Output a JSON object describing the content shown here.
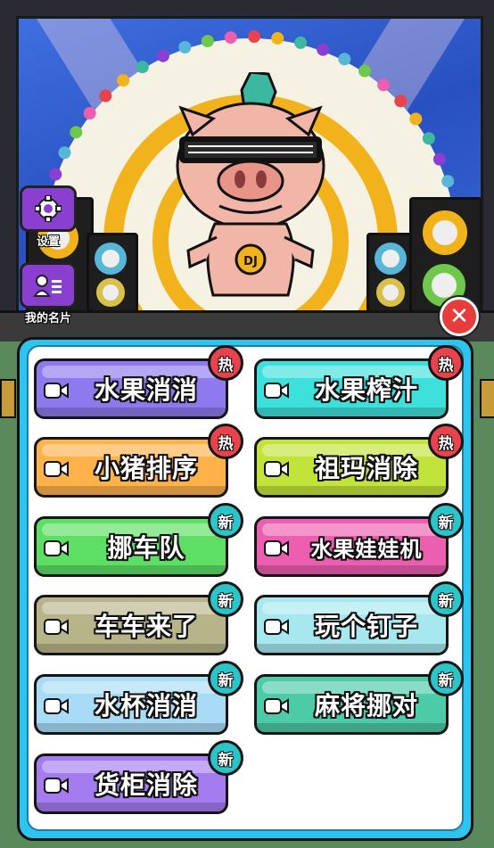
{
  "side_menu": {
    "settings_label": "设置",
    "card_label": "我的名片"
  },
  "pig_medal_text": "DJ",
  "games": [
    {
      "name": "水果消消",
      "badge": "热",
      "badge_type": "hot",
      "color": "#8f79ef"
    },
    {
      "name": "水果榨汁",
      "badge": "热",
      "badge_type": "hot",
      "color": "#3ee0dc"
    },
    {
      "name": "小猪排序",
      "badge": "热",
      "badge_type": "hot",
      "color": "#ffb14a"
    },
    {
      "name": "祖玛消除",
      "badge": "热",
      "badge_type": "hot",
      "color": "#c2e43a"
    },
    {
      "name": "挪车队",
      "badge": "新",
      "badge_type": "new",
      "color": "#5ddf64"
    },
    {
      "name": "水果娃娃机",
      "badge": "新",
      "badge_type": "new",
      "color": "#ec5fb0"
    },
    {
      "name": "车车来了",
      "badge": "新",
      "badge_type": "new",
      "color": "#b8b48a"
    },
    {
      "name": "玩个钉子",
      "badge": "新",
      "badge_type": "new",
      "color": "#a6e8ee"
    },
    {
      "name": "水杯消消",
      "badge": "新",
      "badge_type": "new",
      "color": "#a8dcf6"
    },
    {
      "name": "麻将挪对",
      "badge": "新",
      "badge_type": "new",
      "color": "#4dcaa8"
    },
    {
      "name": "货柜消除",
      "badge": "新",
      "badge_type": "new",
      "color": "#a57cf0"
    }
  ],
  "icons": {
    "settings": "gear-icon",
    "card": "id-card-icon",
    "close": "close-icon",
    "game": "video-camera-icon"
  }
}
